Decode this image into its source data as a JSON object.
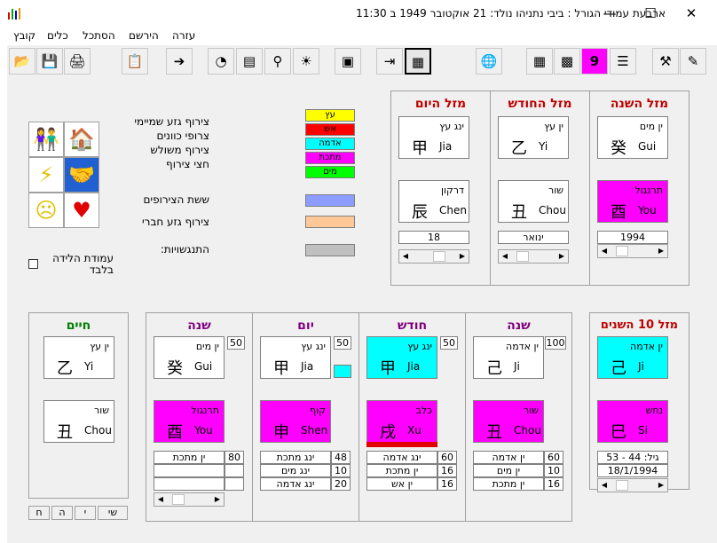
{
  "window": {
    "title": "ארבעת עמודי הגורל : ביבי נתניהו   נולד: 21 אוקטובר 1949 ב 11:30"
  },
  "menu": {
    "file": "קובץ",
    "tools": "כלים",
    "look": "הסתכל",
    "heritage": "הירשם",
    "help": "עזרה"
  },
  "legend": {
    "items": [
      "צירוף גזע שמיימי",
      "צרופי כוונים",
      "צירוף משולש",
      "חצי צירוף"
    ],
    "elements": [
      "עץ",
      "אש",
      "אדמה",
      "מתכת",
      "מים"
    ],
    "six": "ששת הצירופים",
    "friend": "צירוף גזע חברי",
    "clash": "התנגשויות:"
  },
  "only_birth_label": "עמודת הלידה בלבד",
  "top": {
    "year": {
      "title": "מזל השנה",
      "stem": {
        "name": "ין מים",
        "char": "癸",
        "py": "Gui"
      },
      "branch": {
        "name": "תרנגול",
        "char": "酉",
        "py": "You"
      },
      "value": "1994"
    },
    "month": {
      "title": "מזל החודש",
      "stem": {
        "name": "ין עץ",
        "char": "乙",
        "py": "Yi"
      },
      "branch": {
        "name": "שור",
        "char": "丑",
        "py": "Chou"
      },
      "value": "ינואר"
    },
    "day": {
      "title": "מזל היום",
      "stem": {
        "name": "ינג עץ",
        "char": "甲",
        "py": "Jia"
      },
      "branch": {
        "name": "דרקון",
        "char": "辰",
        "py": "Chen"
      },
      "value": "18"
    }
  },
  "life": {
    "title": "חיים",
    "stem": {
      "name": "ין עץ",
      "char": "乙",
      "py": "Yi"
    },
    "branch": {
      "name": "שור",
      "char": "丑",
      "py": "Chou"
    }
  },
  "pillars": {
    "year": {
      "title": "שנה",
      "stem": {
        "name": "ין מים",
        "char": "癸",
        "py": "Gui"
      },
      "branch": {
        "name": "תרנגול",
        "char": "酉",
        "py": "You"
      },
      "num": "50",
      "rows": [
        [
          "ין מתכת",
          "80"
        ],
        [
          "",
          ""
        ],
        [
          "",
          ""
        ]
      ]
    },
    "day": {
      "title": "יום",
      "stem": {
        "name": "ינג עץ",
        "char": "甲",
        "py": "Jia"
      },
      "branch": {
        "name": "קוף",
        "char": "申",
        "py": "Shen"
      },
      "num": "50",
      "rows": [
        [
          "ינג מתכת",
          "48"
        ],
        [
          "ינג מים",
          "10"
        ],
        [
          "ינג אדמה",
          "20"
        ]
      ]
    },
    "month": {
      "title": "חודש",
      "stem": {
        "name": "ינג עץ",
        "char": "甲",
        "py": "Jia"
      },
      "branch": {
        "name": "כלב",
        "char": "戌",
        "py": "Xu"
      },
      "num": "50",
      "rows": [
        [
          "ינג אדמה",
          "60"
        ],
        [
          "ין מתכת",
          "16"
        ],
        [
          "ין אש",
          "16"
        ]
      ]
    },
    "hour": {
      "title": "שנה",
      "stem": {
        "name": "ין אדמה",
        "char": "己",
        "py": "Ji"
      },
      "branch": {
        "name": "שור",
        "char": "丑",
        "py": "Chou"
      },
      "num": "100",
      "rows": [
        [
          "ין אדמה",
          "60"
        ],
        [
          "ין מים",
          "10"
        ],
        [
          "ין מתכת",
          "16"
        ]
      ]
    }
  },
  "decade": {
    "title": "מזל 10 השנים",
    "stem": {
      "name": "ין אדמה",
      "char": "己",
      "py": "Ji"
    },
    "branch": {
      "name": "נחש",
      "char": "巳",
      "py": "Si"
    },
    "age": "גיל: 44 - 53",
    "date": "18/1/1994"
  },
  "bottom_tabs": [
    "שי",
    "י",
    "ה",
    "ח"
  ],
  "colors": {
    "wood": "#ffff00",
    "fire": "#ff0000",
    "earth": "#00ffff",
    "metal": "#ff00ff",
    "water": "#00ff00",
    "six": "#8c9dff",
    "friend": "#ffc896",
    "clash": "#c0c0c0",
    "red_title": "#c00000",
    "purple_title": "#800080",
    "green_title": "#008000"
  },
  "icons": [
    "open-folder-icon",
    "save-icon",
    "print-icon",
    "form-icon",
    "arrow-right-icon",
    "pie-chart-icon",
    "bar-chart-icon",
    "magnifier-icon",
    "bulb-icon",
    "book-icon",
    "export-icon",
    "presentation-icon",
    "globe-icon",
    "grid-icon",
    "calendar-grid-icon",
    "nine-icon",
    "list-icon",
    "tools-icon",
    "book-pen-icon"
  ]
}
